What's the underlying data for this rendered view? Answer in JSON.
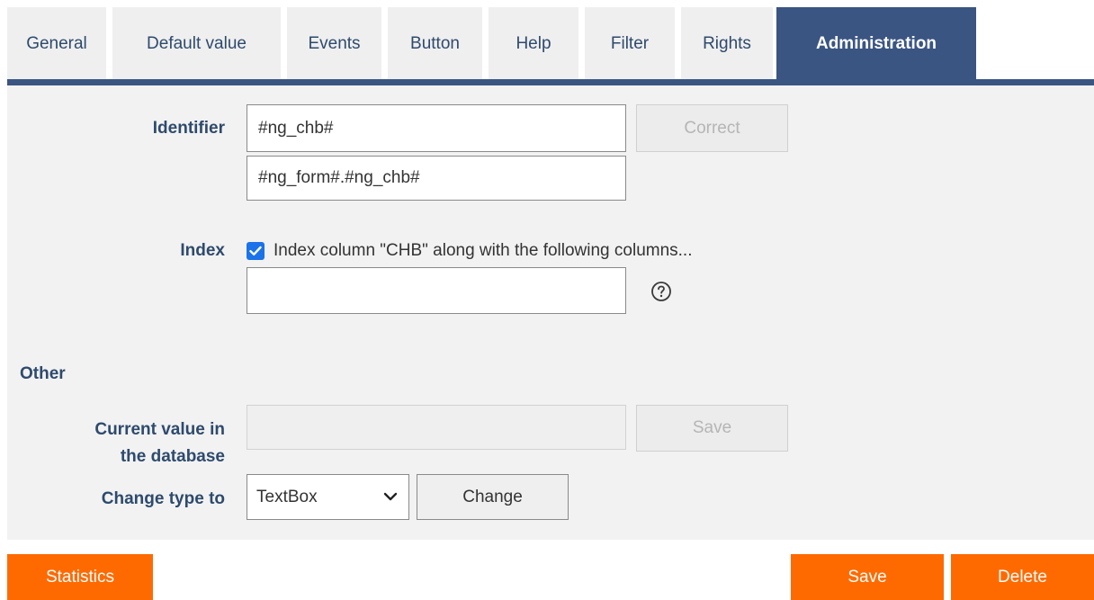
{
  "tabs": [
    {
      "label": "General"
    },
    {
      "label": "Default value"
    },
    {
      "label": "Events"
    },
    {
      "label": "Button"
    },
    {
      "label": "Help"
    },
    {
      "label": "Filter"
    },
    {
      "label": "Rights"
    },
    {
      "label": "Administration"
    }
  ],
  "active_tab": "Administration",
  "identifier": {
    "label": "Identifier",
    "value": "#ng_chb#",
    "full_value": "#ng_form#.#ng_chb#",
    "correct_button": "Correct"
  },
  "index": {
    "label": "Index",
    "checked": true,
    "checkbox_label": "Index column \"CHB\" along with the following columns...",
    "columns_value": "",
    "help_icon": "question-circle-icon"
  },
  "other": {
    "section_title": "Other",
    "current_value_label_line1": "Current value in",
    "current_value_label_line2": "the database",
    "current_value": "",
    "save_button": "Save",
    "change_type_label": "Change type to",
    "change_type_value": "TextBox",
    "change_button": "Change"
  },
  "footer": {
    "statistics_button": "Statistics",
    "save_button": "Save",
    "delete_button": "Delete"
  },
  "colors": {
    "accent": "#3a5582",
    "tab_bg": "#efefef",
    "panel_bg": "#f2f2f2",
    "label_text": "#2e4a6d",
    "action_orange": "#ff6a00",
    "checkbox_blue": "#1a73e8"
  }
}
